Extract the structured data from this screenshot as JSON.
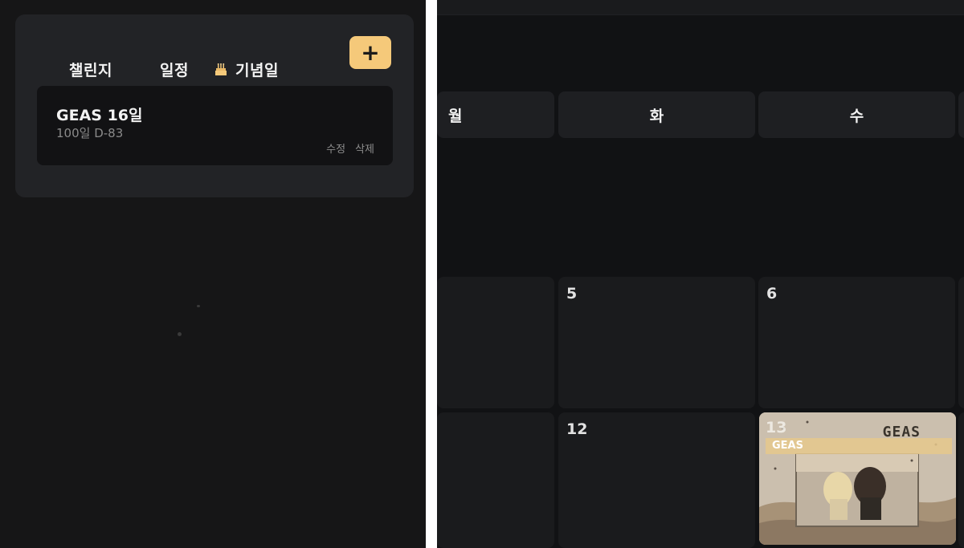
{
  "tabs": {
    "challenge": "챌린지",
    "schedule": "일정",
    "anniversary": "기념일",
    "add": "+"
  },
  "event": {
    "title": "GEAS 16일",
    "subtitle": "100일 D-83",
    "edit": "수정",
    "delete": "삭제"
  },
  "calendar": {
    "weekdays": [
      "월",
      "화",
      "수"
    ],
    "days": [
      "5",
      "6",
      "12",
      "13"
    ],
    "event_badge": "GEAS",
    "event_brand": "GEAS"
  },
  "colors": {
    "accent": "#f5c97a",
    "background_left": "#161617",
    "background_right": "#111214",
    "card": "#222326",
    "cell": "#1a1b1d"
  },
  "icons": {
    "anniversary": "cake-icon",
    "add": "plus-icon"
  }
}
